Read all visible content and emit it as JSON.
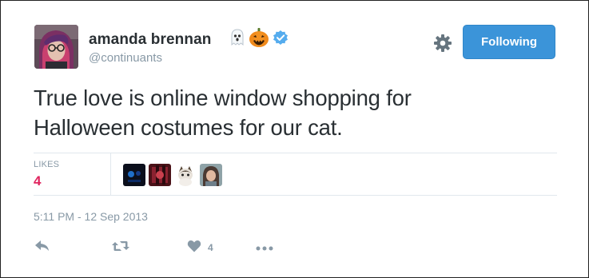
{
  "tweet": {
    "author": {
      "display_name": "amanda brennan",
      "handle": "@continuants",
      "emojis": [
        "ghost-emoji",
        "jack-o-lantern-emoji"
      ],
      "verified": true
    },
    "follow_button_label": "Following",
    "text_lines": [
      "True love is online window shopping for",
      "Halloween costumes for our cat."
    ],
    "likes": {
      "label": "LIKES",
      "count": "4"
    },
    "timestamp": "5:11 PM - 12 Sep 2013",
    "actions": {
      "like_count": "4"
    }
  },
  "colors": {
    "follow_button": "#3b94d9",
    "likes_count": "#e0245e",
    "verified_badge": "#55acee",
    "secondary_text": "#8899a6"
  },
  "icons": [
    "settings-gear-icon",
    "reply-icon",
    "retweet-icon",
    "heart-icon",
    "more-icon"
  ]
}
